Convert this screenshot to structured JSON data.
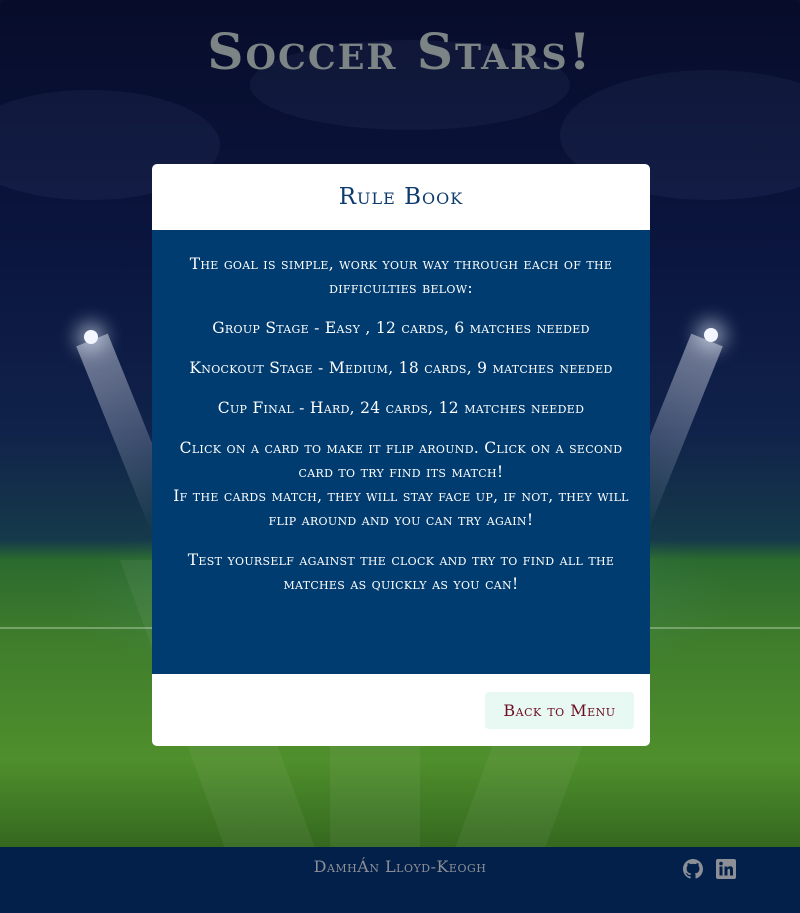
{
  "header": {
    "title": "Soccer Stars!"
  },
  "modal": {
    "title": "Rule Book",
    "paragraphs": {
      "intro": "The goal is simple, work your way through each of the difficulties below:",
      "group_stage": "Group Stage - Easy , 12 cards, 6 matches needed",
      "knockout_stage": "Knockout Stage - Medium, 18 cards, 9 matches needed",
      "cup_final": "Cup Final - Hard, 24 cards, 12 matches needed",
      "how_to_line1": "Click on a card to make it flip around. Click on a second card to try find its match!",
      "how_to_line2": "If the cards match, they will stay face up, if not, they will flip around and you can try again!",
      "closing": "Test yourself against the clock and try to find all the matches as quickly as you can!"
    },
    "back_button_label": "Back to Menu"
  },
  "footer": {
    "author": "DamhÁn Lloyd-Keogh",
    "icons": [
      "github-icon",
      "linkedin-icon"
    ]
  },
  "colors": {
    "modal_body": "#003c70",
    "title_blue": "#0d3b6e",
    "button_bg": "#e8f8f3",
    "button_text": "#6d0d22",
    "footer_bg": "#02204a"
  }
}
